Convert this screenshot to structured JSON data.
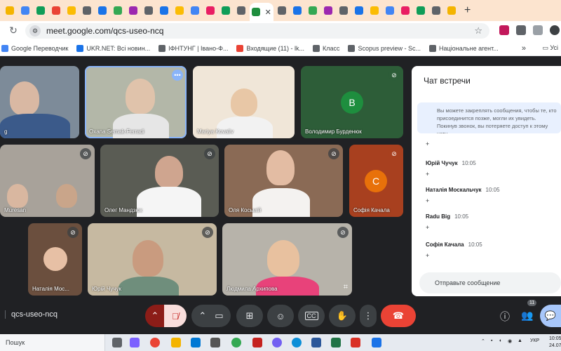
{
  "browser": {
    "url": "meet.google.com/qcs-useo-ncq",
    "tabs_count": 29,
    "active_tab_close": "✕",
    "new_tab": "+"
  },
  "bookmarks": [
    {
      "label": "Google Переводчик",
      "color": "#4285f4"
    },
    {
      "label": "UKR.NET: Всі новин...",
      "color": "#1a73e8"
    },
    {
      "label": "ІФНТУНГ | Івано-Ф...",
      "color": "#5f6368"
    },
    {
      "label": "Входящие (11) - lk...",
      "color": "#ea4335"
    },
    {
      "label": "Класс",
      "color": "#5f6368"
    },
    {
      "label": "Scopus preview - Sc...",
      "color": "#5f6368"
    },
    {
      "label": "Національне агент...",
      "color": "#5f6368"
    }
  ],
  "bookmarks_more": "»",
  "bookmarks_folder": "Усі",
  "participants": [
    {
      "name": "g",
      "muted": false
    },
    {
      "name": "Oxana Semak-Ferradi",
      "muted": false,
      "active": true
    },
    {
      "name": "Mariya Kovaliv",
      "muted": false
    },
    {
      "name": "Володимир Бурденюк",
      "muted": true,
      "initial": "В",
      "avatar_color": "#1e8e3e"
    },
    {
      "name": "Muresan",
      "muted": true
    },
    {
      "name": "Олег Мандзюк",
      "muted": true
    },
    {
      "name": "Оля Косьмій",
      "muted": true
    },
    {
      "name": "Софія Качала",
      "muted": true,
      "initial": "С",
      "avatar_color": "#e8710a"
    },
    {
      "name": "Наталія Мос...",
      "muted": true
    },
    {
      "name": "Юрій Чучук",
      "muted": true
    },
    {
      "name": "Людмила Архипова",
      "muted": true
    }
  ],
  "chat": {
    "title": "Чат встречи",
    "info": "Вы можете закреплять сообщения, чтобы те, кто присоединится позже, могли их увидеть. Покинув звонок, вы потеряете доступ к этому чату.",
    "messages": [
      {
        "author": "Юрій Чучук",
        "time": "10:05",
        "text": "+"
      },
      {
        "author": "Наталія Москальчук",
        "time": "10:05",
        "text": "+"
      },
      {
        "author": "Radu Big",
        "time": "10:05",
        "text": "+"
      },
      {
        "author": "Софія Качала",
        "time": "10:05",
        "text": "+"
      }
    ],
    "first_plus": "+",
    "input_placeholder": "Отправьте сообщение"
  },
  "meeting": {
    "code": "qcs-useo-ncq",
    "people_count": "11"
  },
  "taskbar": {
    "search": "Пошук",
    "lang": "УКР",
    "time": "10:05",
    "date": "24.07.20"
  },
  "icons": {
    "mic_chevron": "^",
    "mic_off": "mic-off",
    "cam_chevron": "^",
    "camera": "camera",
    "present": "present",
    "emoji": "emoji",
    "captions": "captions",
    "raise_hand": "hand",
    "more": "more",
    "hangup": "hangup",
    "info": "info",
    "people": "people",
    "chat": "chat"
  }
}
